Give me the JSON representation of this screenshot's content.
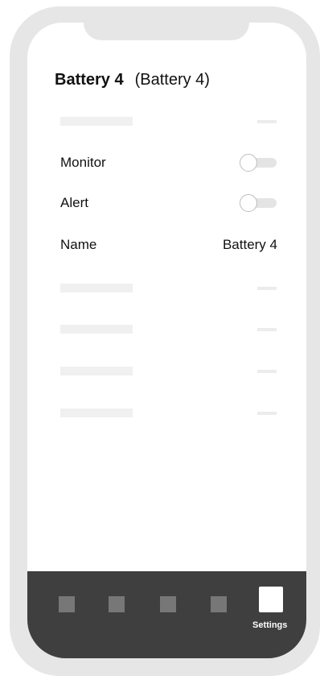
{
  "header": {
    "title": "Battery 4",
    "subtitle": "(Battery 4)"
  },
  "settings": {
    "monitor": {
      "label": "Monitor",
      "enabled": false
    },
    "alert": {
      "label": "Alert",
      "enabled": false
    },
    "name": {
      "label": "Name",
      "value": "Battery 4"
    }
  },
  "tabbar": {
    "active_tab": "settings",
    "settings_label": "Settings"
  }
}
